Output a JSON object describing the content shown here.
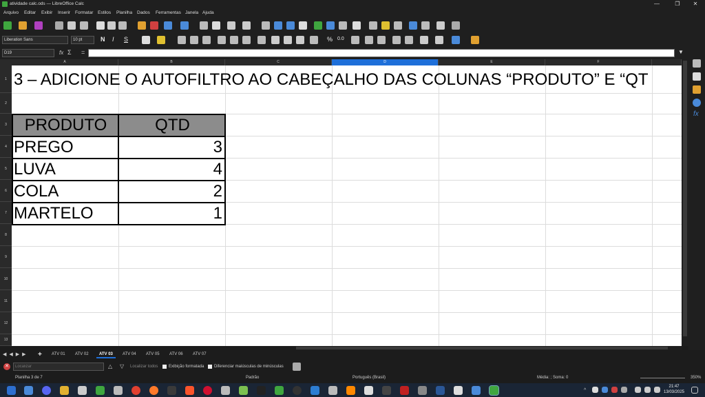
{
  "window": {
    "title": "atividade calc.ods — LibreOffice Calc",
    "minimize": "—",
    "maximize": "❐",
    "close": "✕"
  },
  "menu": [
    "Arquivo",
    "Editar",
    "Exibir",
    "Inserir",
    "Formatar",
    "Estilos",
    "Planilha",
    "Dados",
    "Ferramentas",
    "Janela",
    "Ajuda"
  ],
  "toolbar": {
    "font_name": "Liberation Sans",
    "font_size": "10 pt",
    "bold": "N",
    "italic": "I",
    "underline": "S",
    "percent": "%",
    "decimal": "0.0"
  },
  "formula": {
    "name_box": "D19",
    "fx": "fx",
    "sigma": "Σ",
    "equals": "=",
    "content": ""
  },
  "columns": [
    "A",
    "B",
    "C",
    "D",
    "E",
    "F"
  ],
  "rows": [
    "1",
    "2",
    "3",
    "4",
    "5",
    "6",
    "7",
    "8",
    "9",
    "10",
    "11",
    "12",
    "13"
  ],
  "sheet": {
    "heading": "3 – ADICIONE O AUTOFILTRO AO CABEÇALHO DAS COLUNAS “PRODUTO” E “QT",
    "table_headers": [
      "PRODUTO",
      "QTD"
    ],
    "table_rows": [
      [
        "PREGO",
        "3"
      ],
      [
        "LUVA",
        "4"
      ],
      [
        "COLA",
        "2"
      ],
      [
        "MARTELO",
        "1"
      ]
    ]
  },
  "sheet_tabs": [
    "ATV 01",
    "ATV 02",
    "ATV 03",
    "ATV 04",
    "ATV 05",
    "ATV 06",
    "ATV 07"
  ],
  "active_tab": "ATV 03",
  "find": {
    "placeholder": "Localizar",
    "find_all": "Localizar todos",
    "formatted": "Exibição formatada",
    "match_case": "Diferenciar maiúsculas de minúsculas"
  },
  "status": {
    "sheet": "Planilha 3 de 7",
    "style": "Padrão",
    "language": "Português (Brasil)",
    "sum": "Média: ; Soma: 0",
    "zoom": "350%"
  },
  "clock": {
    "time": "21:47",
    "date": "13/03/2025"
  },
  "colors": {
    "accent": "#1e6fd9",
    "header_fill": "#8c8c8c"
  }
}
